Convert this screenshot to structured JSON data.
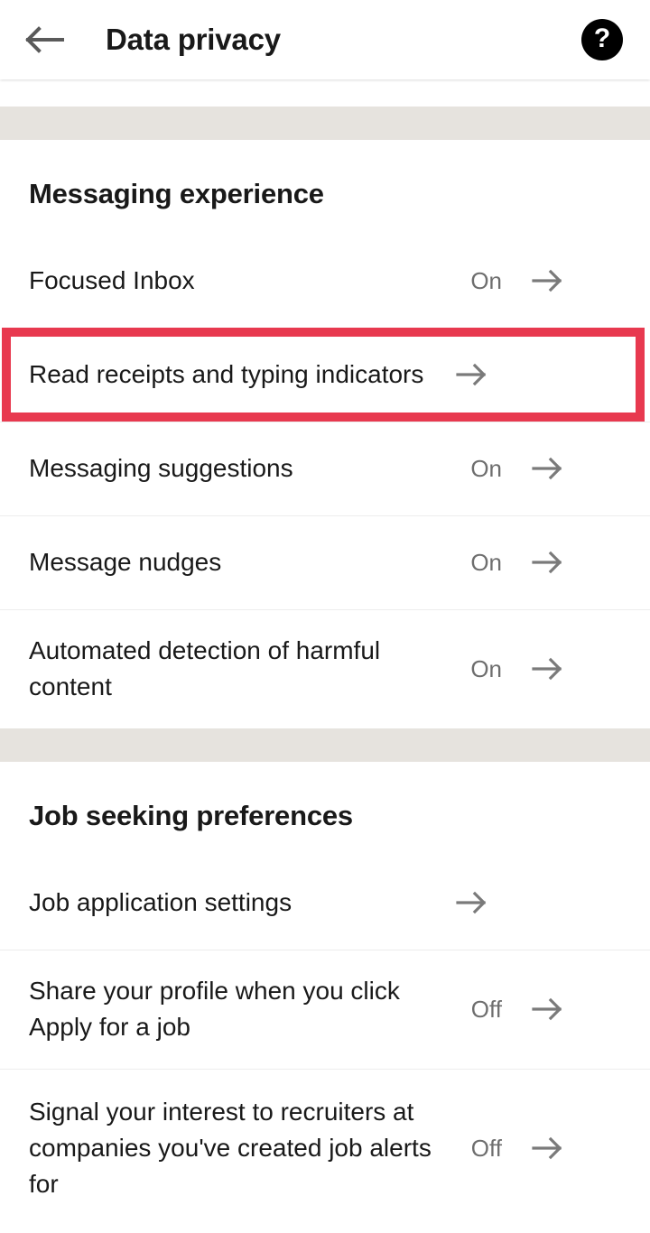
{
  "header": {
    "title": "Data privacy",
    "back_icon": "arrow-left-icon",
    "help_icon": "question-mark-circle-icon",
    "help_glyph": "?"
  },
  "accent": {
    "highlight_red": "#E8394F",
    "band_gray": "#E6E3DE",
    "divider_gray": "#EDEDED",
    "value_gray": "#6E6E6E",
    "text_black": "#191919"
  },
  "sections": [
    {
      "title": "Messaging experience",
      "rows": [
        {
          "label": "Focused Inbox",
          "value": "On",
          "chevron": "arrow-right-icon",
          "highlighted": false
        },
        {
          "label": "Read receipts and typing indicators",
          "value": "",
          "chevron": "arrow-right-icon",
          "highlighted": true
        },
        {
          "label": "Messaging suggestions",
          "value": "On",
          "chevron": "arrow-right-icon",
          "highlighted": false
        },
        {
          "label": "Message nudges",
          "value": "On",
          "chevron": "arrow-right-icon",
          "highlighted": false
        },
        {
          "label": "Automated detection of harmful content",
          "value": "On",
          "chevron": "arrow-right-icon",
          "highlighted": false
        }
      ]
    },
    {
      "title": "Job seeking preferences",
      "rows": [
        {
          "label": "Job application settings",
          "value": "",
          "chevron": "arrow-right-icon",
          "highlighted": false
        },
        {
          "label": "Share your profile when you click Apply for a job",
          "value": "Off",
          "chevron": "arrow-right-icon",
          "highlighted": false
        },
        {
          "label": "Signal your interest to recruiters at companies you've created job alerts for",
          "value": "Off",
          "chevron": "arrow-right-icon",
          "highlighted": false
        }
      ]
    }
  ]
}
